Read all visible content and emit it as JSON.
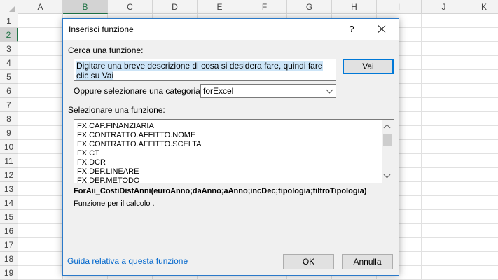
{
  "spreadsheet": {
    "columns": [
      "A",
      "B",
      "C",
      "D",
      "E",
      "F",
      "G",
      "H",
      "I",
      "J",
      "K"
    ],
    "rows": [
      "1",
      "2",
      "3",
      "4",
      "5",
      "6",
      "7",
      "8",
      "9",
      "10",
      "11",
      "12",
      "13",
      "14",
      "15",
      "16",
      "17",
      "18",
      "19"
    ],
    "selected_column": "B",
    "selected_row": "2",
    "accent_color": "#217346"
  },
  "dialog": {
    "title": "Inserisci funzione",
    "help_glyph": "?",
    "search_label": "Cerca una funzione:",
    "search_value": "Digitare una breve descrizione di cosa si desidera fare, quindi fare clic su Vai",
    "go_button": "Vai",
    "category_label": "Oppure selezionare una categoria:",
    "category_value": "forExcel",
    "select_label": "Selezionare una funzione:",
    "functions": [
      "FX.CAP.FINANZIARIA",
      "FX.CONTRATTO.AFFITTO.NOME",
      "FX.CONTRATTO.AFFITTO.SCELTA",
      "FX.CT",
      "FX.DCR",
      "FX.DEP.LINEARE",
      "FX.DEP.METODO"
    ],
    "syntax": "ForAii_CostiDistAnni(euroAnno;daAnno;aAnno;incDec;tipologia;filtroTipologia)",
    "description": "Funzione per il calcolo .",
    "help_link": "Guida relativa a questa funzione",
    "ok_button": "OK",
    "cancel_button": "Annulla",
    "title_bar_color": "#ffffff",
    "border_color": "#2b79c9",
    "link_color": "#0066cc"
  }
}
